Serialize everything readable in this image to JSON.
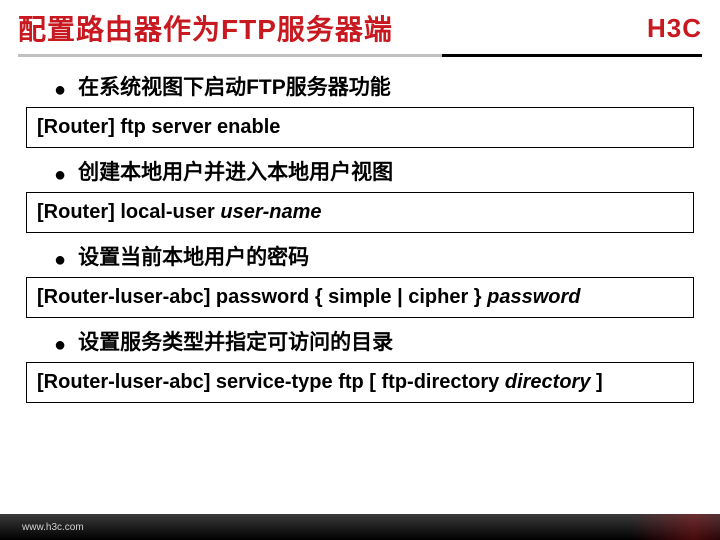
{
  "header": {
    "title": "配置路由器作为FTP服务器端",
    "logo": "H3C"
  },
  "bullets": {
    "b1": "在系统视图下启动FTP服务器功能",
    "b2": "创建本地用户并进入本地用户视图",
    "b3": "设置当前本地用户的密码",
    "b4": "设置服务类型并指定可访问的目录"
  },
  "cmds": {
    "c1_full": "[Router] ftp server enable",
    "c2_prefix": "[Router] local-user ",
    "c2_param": "user-name",
    "c3_prefix": "[Router-luser-abc] password { simple | cipher } ",
    "c3_param": "password",
    "c4_prefix": "[Router-luser-abc] service-type ftp [ ftp-directory ",
    "c4_param": "directory",
    "c4_suffix": " ]"
  },
  "footer": {
    "url": "www.h3c.com"
  }
}
